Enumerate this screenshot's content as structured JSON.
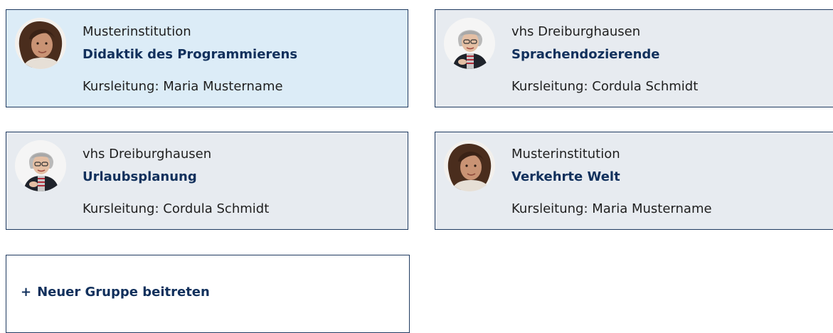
{
  "groups": [
    {
      "institution": "Musterinstitution",
      "title": "Didaktik des Programmierens",
      "leader": "Kursleitung: Maria Mustername",
      "avatar": "curly-hair-woman-avatar",
      "selected": true
    },
    {
      "institution": "vhs Dreiburghausen",
      "title": "Sprachendozierende",
      "leader": "Kursleitung: Cordula Schmidt",
      "avatar": "gray-hair-woman-avatar",
      "selected": false
    },
    {
      "institution": "vhs Dreiburghausen",
      "title": "Urlaubsplanung",
      "leader": "Kursleitung: Cordula Schmidt",
      "avatar": "gray-hair-woman-avatar",
      "selected": false
    },
    {
      "institution": "Musterinstitution",
      "title": "Verkehrte Welt",
      "leader": "Kursleitung: Maria Mustername",
      "avatar": "curly-hair-woman-avatar",
      "selected": false
    }
  ],
  "join": {
    "icon": "plus-icon",
    "plus": "+",
    "label": "Neuer Gruppe beitreten"
  },
  "colors": {
    "card_background": "#e7ebf0",
    "selected_background": "#dcecf7",
    "border": "#1f3a60",
    "title_text": "#11305c"
  }
}
